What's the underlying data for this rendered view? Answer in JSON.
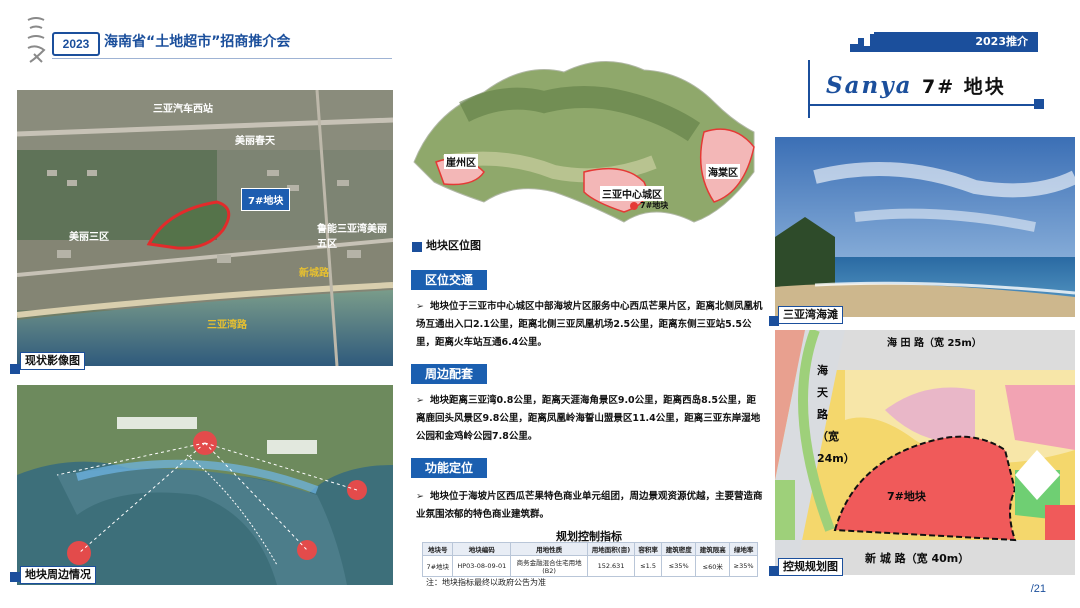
{
  "header": {
    "year": "2023",
    "title": "海南省“土地超市”招商推介会",
    "ribbon": "2023推介",
    "brand": "Sanya",
    "plot_name": "7# 地块"
  },
  "colors": {
    "primary": "#1b4f9c",
    "plot_red": "#e53935",
    "section_blue": "#1b5fb0"
  },
  "left_top": {
    "caption": "现状影像图",
    "labels": [
      "三亚汽车西站",
      "美丽春天",
      "美丽三区",
      "鲁能三亚湾美丽五区",
      "新城路",
      "三亚湾路"
    ],
    "plot_tag": "7#地块"
  },
  "left_bottom": {
    "caption": "地块周边情况"
  },
  "center_map": {
    "caption": "地块区位图",
    "labels": [
      "崖州区",
      "海棠区",
      "三亚中心城区",
      "7#地块"
    ]
  },
  "sections": [
    {
      "title": "区位交通",
      "text": "地块位于三亚市中心城区中部海坡片区服务中心西瓜芒果片区，距离北侧凤凰机场互通出入口2.1公里，距离北侧三亚凤凰机场2.5公里，距离东侧三亚站5.5公里，距离火车站互通6.4公里。"
    },
    {
      "title": "周边配套",
      "text": "地块距离三亚湾0.8公里，距离天涯海角景区9.0公里，距离西岛8.5公里，距离鹿回头风景区9.8公里，距离凤凰岭海誓山盟景区11.4公里，距离三亚东岸湿地公园和金鸡岭公园7.8公里。"
    },
    {
      "title": "功能定位",
      "text": "地块位于海坡片区西瓜芒果特色商业单元组团，周边景观资源优越，主要营造商业氛围浓郁的特色商业建筑群。"
    }
  ],
  "table": {
    "title": "规划控制指标",
    "headers": [
      "地块号",
      "地块编码",
      "用地性质",
      "用地面积(亩)",
      "容积率",
      "建筑密度",
      "建筑限高",
      "绿地率"
    ],
    "row": [
      "7#地块",
      "HP03-08-09-01",
      "商务金融混合住宅用地(B2)",
      "152.631",
      "≤1.5",
      "≤35%",
      "≤60米",
      "≥35%"
    ],
    "note": "注：地块指标最终以政府公告为准"
  },
  "right_photo": {
    "caption": "三亚湾海滩"
  },
  "right_plan": {
    "caption": "控规规划图",
    "plot_label": "7#地块",
    "road_top": "海 田 路（宽 25m）",
    "road_diag": "海天路（宽24m）",
    "road_bottom": "新 城 路（宽 40m）"
  },
  "page": "/21"
}
